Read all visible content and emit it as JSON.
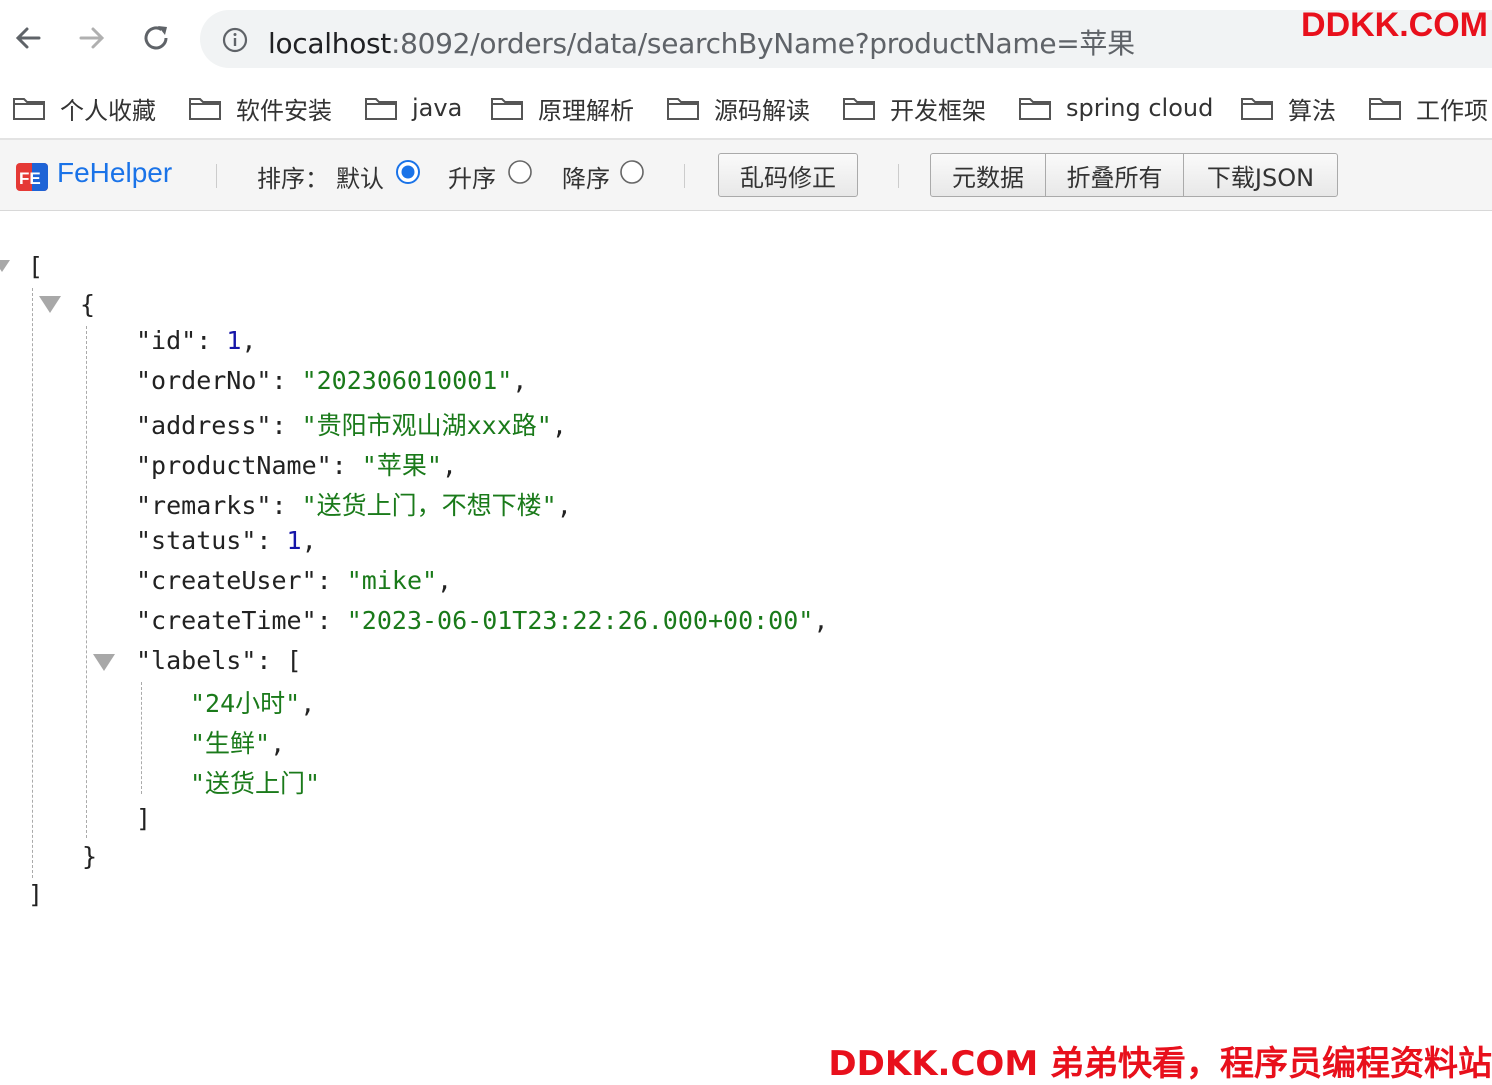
{
  "browser": {
    "url_host": "localhost",
    "url_path": ":8092/orders/data/searchByName?productName=苹果",
    "icons": [
      "back-arrow-icon",
      "forward-arrow-icon",
      "reload-icon",
      "site-info-icon"
    ]
  },
  "watermark": {
    "top": "DDKK.COM",
    "bottom": "DDKK.COM 弟弟快看，程序员编程资料站"
  },
  "bookmarks": [
    {
      "label": "个人收藏"
    },
    {
      "label": "软件安装"
    },
    {
      "label": "java"
    },
    {
      "label": "原理解析"
    },
    {
      "label": "源码解读"
    },
    {
      "label": "开发框架"
    },
    {
      "label": "spring cloud"
    },
    {
      "label": "算法"
    },
    {
      "label": "工作项"
    }
  ],
  "toolbar": {
    "app_name": "FeHelper",
    "sort_label": "排序：",
    "sort_default": "默认",
    "sort_asc": "升序",
    "sort_desc": "降序",
    "sort_selected": "默认",
    "fix_button": "乱码修正",
    "meta_button": "元数据",
    "collapse_button": "折叠所有",
    "download_button": "下载JSON"
  },
  "json": {
    "open_array": "[",
    "open_object": "{",
    "fields": [
      {
        "key": "\"id\"",
        "value": "1",
        "type": "number"
      },
      {
        "key": "\"orderNo\"",
        "value": "\"202306010001\"",
        "type": "string"
      },
      {
        "key": "\"address\"",
        "value": "\"贵阳市观山湖xxx路\"",
        "type": "string"
      },
      {
        "key": "\"productName\"",
        "value": "\"苹果\"",
        "type": "string"
      },
      {
        "key": "\"remarks\"",
        "value": "\"送货上门，不想下楼\"",
        "type": "string"
      },
      {
        "key": "\"status\"",
        "value": "1",
        "type": "number"
      },
      {
        "key": "\"createUser\"",
        "value": "\"mike\"",
        "type": "string"
      },
      {
        "key": "\"createTime\"",
        "value": "\"2023-06-01T23:22:26.000+00:00\"",
        "type": "string"
      }
    ],
    "labels_key": "\"labels\"",
    "labels": [
      "\"24小时\"",
      "\"生鲜\"",
      "\"送货上门\""
    ],
    "close_labels": "]",
    "close_object": "}",
    "close_array": "]"
  }
}
